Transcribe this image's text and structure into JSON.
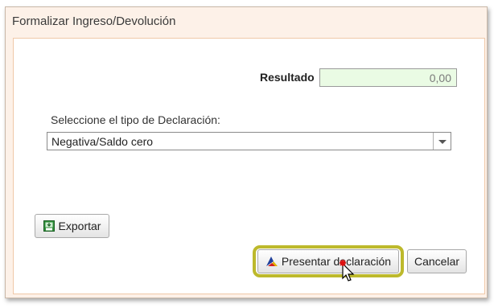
{
  "dialog": {
    "title": "Formalizar Ingreso/Devolución"
  },
  "resultado": {
    "label": "Resultado",
    "value": "0,00"
  },
  "tipo_declaracion": {
    "label": "Seleccione el tipo de Declaración:",
    "selected": "Negativa/Saldo cero"
  },
  "buttons": {
    "exportar": "Exportar",
    "presentar": "Presentar declaración",
    "cancelar": "Cancelar"
  },
  "icons": {
    "exportar": "export-icon",
    "presentar": "aeat-logo-icon",
    "dropdown": "chevron-down-icon",
    "cursor": "mouse-pointer-icon"
  },
  "colors": {
    "highlight": "#bdb92c",
    "resultado_bg": "#eafbe4",
    "dialog_bg": "#fdf1e8"
  }
}
